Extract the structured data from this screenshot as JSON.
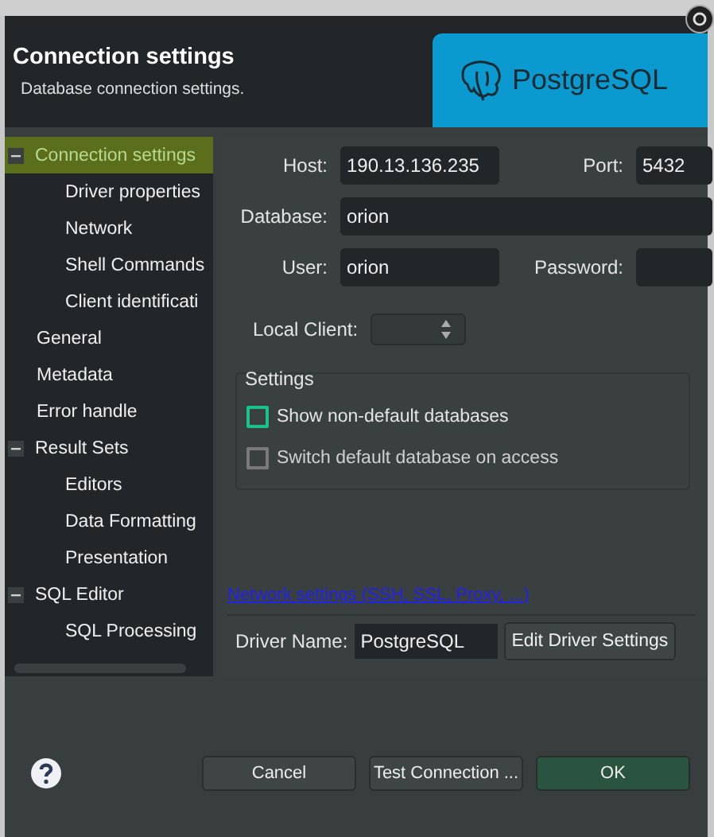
{
  "dialog": {
    "title": "Connection settings",
    "subtitle": "Database connection settings.",
    "logo_text": "PostgreSQL"
  },
  "tree": [
    {
      "label": "Connection settings",
      "selected": true,
      "expanded": true,
      "children": [
        {
          "label": "Driver properties",
          "selected": false
        },
        {
          "label": "Network",
          "selected": false
        },
        {
          "label": "Shell Commands",
          "selected": false
        },
        {
          "label": "Client identificati",
          "selected": false
        }
      ]
    },
    {
      "label": "General",
      "selected": false
    },
    {
      "label": "Metadata",
      "selected": false
    },
    {
      "label": "Error handle",
      "selected": false
    },
    {
      "label": "Result Sets",
      "selected": false,
      "expanded": true,
      "children": [
        {
          "label": "Editors",
          "selected": false
        },
        {
          "label": "Data Formatting",
          "selected": false
        },
        {
          "label": "Presentation",
          "selected": false
        }
      ]
    },
    {
      "label": "SQL Editor",
      "selected": false,
      "expanded": true,
      "children": [
        {
          "label": "SQL Processing",
          "selected": false
        }
      ]
    }
  ],
  "form": {
    "host": {
      "label": "Host:",
      "value": "190.13.136.235"
    },
    "port": {
      "label": "Port:",
      "value": "5432"
    },
    "database": {
      "label": "Database:",
      "value": "orion"
    },
    "user": {
      "label": "User:",
      "value": "orion"
    },
    "password": {
      "label": "Password:"
    },
    "local_client": {
      "label": "Local Client:"
    }
  },
  "settings": {
    "title": "Settings",
    "options": [
      {
        "label": "Show non-default databases",
        "checked": false,
        "focused": true
      },
      {
        "label": "Switch default database on access",
        "checked": false,
        "focused": false
      }
    ]
  },
  "network_link": "Network settings (SSH, SSL, Proxy, ...)",
  "driver": {
    "label": "Driver Name:",
    "value": "PostgreSQL",
    "button": "Edit Driver Settings"
  },
  "buttons": [
    {
      "label": "Cancel",
      "kind": "normal"
    },
    {
      "label": "Test Connection ...",
      "kind": "normal"
    },
    {
      "label": "OK",
      "kind": "default"
    }
  ]
}
